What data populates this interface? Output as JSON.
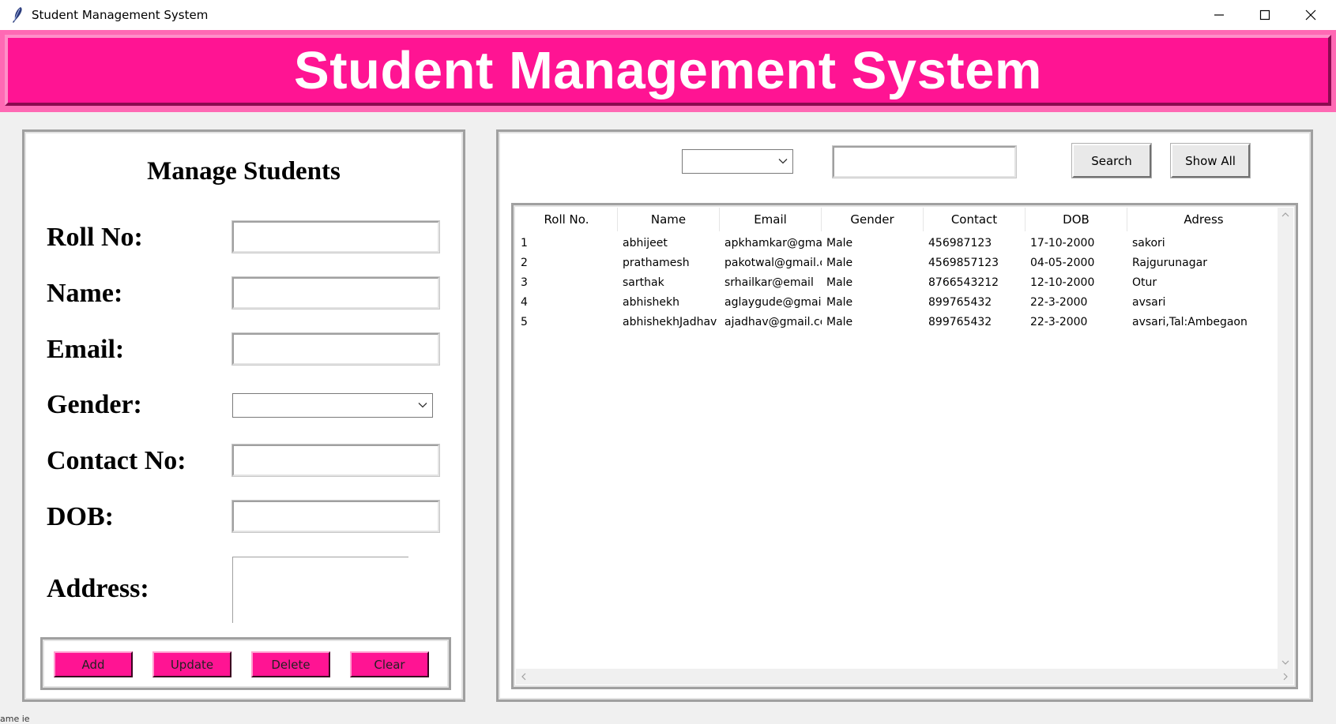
{
  "window": {
    "title": "Student Management System",
    "controls": [
      "minimize",
      "maximize",
      "close"
    ]
  },
  "header": {
    "title": "Student Management System",
    "colors": {
      "bg": "#ff1493",
      "border_light": "#ff8fc8",
      "border_dark": "#8b0a50"
    }
  },
  "manage": {
    "title": "Manage Students",
    "fields": {
      "roll": {
        "label": "Roll No:",
        "value": ""
      },
      "name": {
        "label": "Name:",
        "value": ""
      },
      "email": {
        "label": "Email:",
        "value": ""
      },
      "gender": {
        "label": "Gender:",
        "value": ""
      },
      "contact": {
        "label": "Contact No:",
        "value": ""
      },
      "dob": {
        "label": "DOB:",
        "value": ""
      },
      "address": {
        "label": "Address:",
        "value": ""
      }
    },
    "buttons": {
      "add": "Add",
      "update": "Update",
      "delete": "Delete",
      "clear": "Clear"
    },
    "button_color": "#ff1493"
  },
  "search": {
    "by_value": "",
    "text_value": "",
    "search_label": "Search",
    "show_all_label": "Show All"
  },
  "table": {
    "columns": [
      "Roll No.",
      "Name",
      "Email",
      "Gender",
      "Contact",
      "DOB",
      "Adress"
    ],
    "rows": [
      [
        "1",
        "abhijeet",
        "apkhamkar@gma",
        "Male",
        "456987123",
        "17-10-2000",
        "sakori"
      ],
      [
        "2",
        "prathamesh",
        "pakotwal@gmail.c",
        "Male",
        "4569857123",
        "04-05-2000",
        "Rajgurunagar"
      ],
      [
        "3",
        "sarthak",
        "srhailkar@email",
        "Male",
        "8766543212",
        "12-10-2000",
        "Otur"
      ],
      [
        "4",
        "abhishekh",
        "aglaygude@gmail",
        "Male",
        "899765432",
        "22-3-2000",
        "avsari"
      ],
      [
        "5",
        "abhishekhJadhav",
        "ajadhav@gmail.cc",
        "Male",
        "899765432",
        "22-3-2000",
        "avsari,Tal:Ambegaon"
      ]
    ]
  },
  "footer": {
    "cut_text": "ame ie"
  }
}
